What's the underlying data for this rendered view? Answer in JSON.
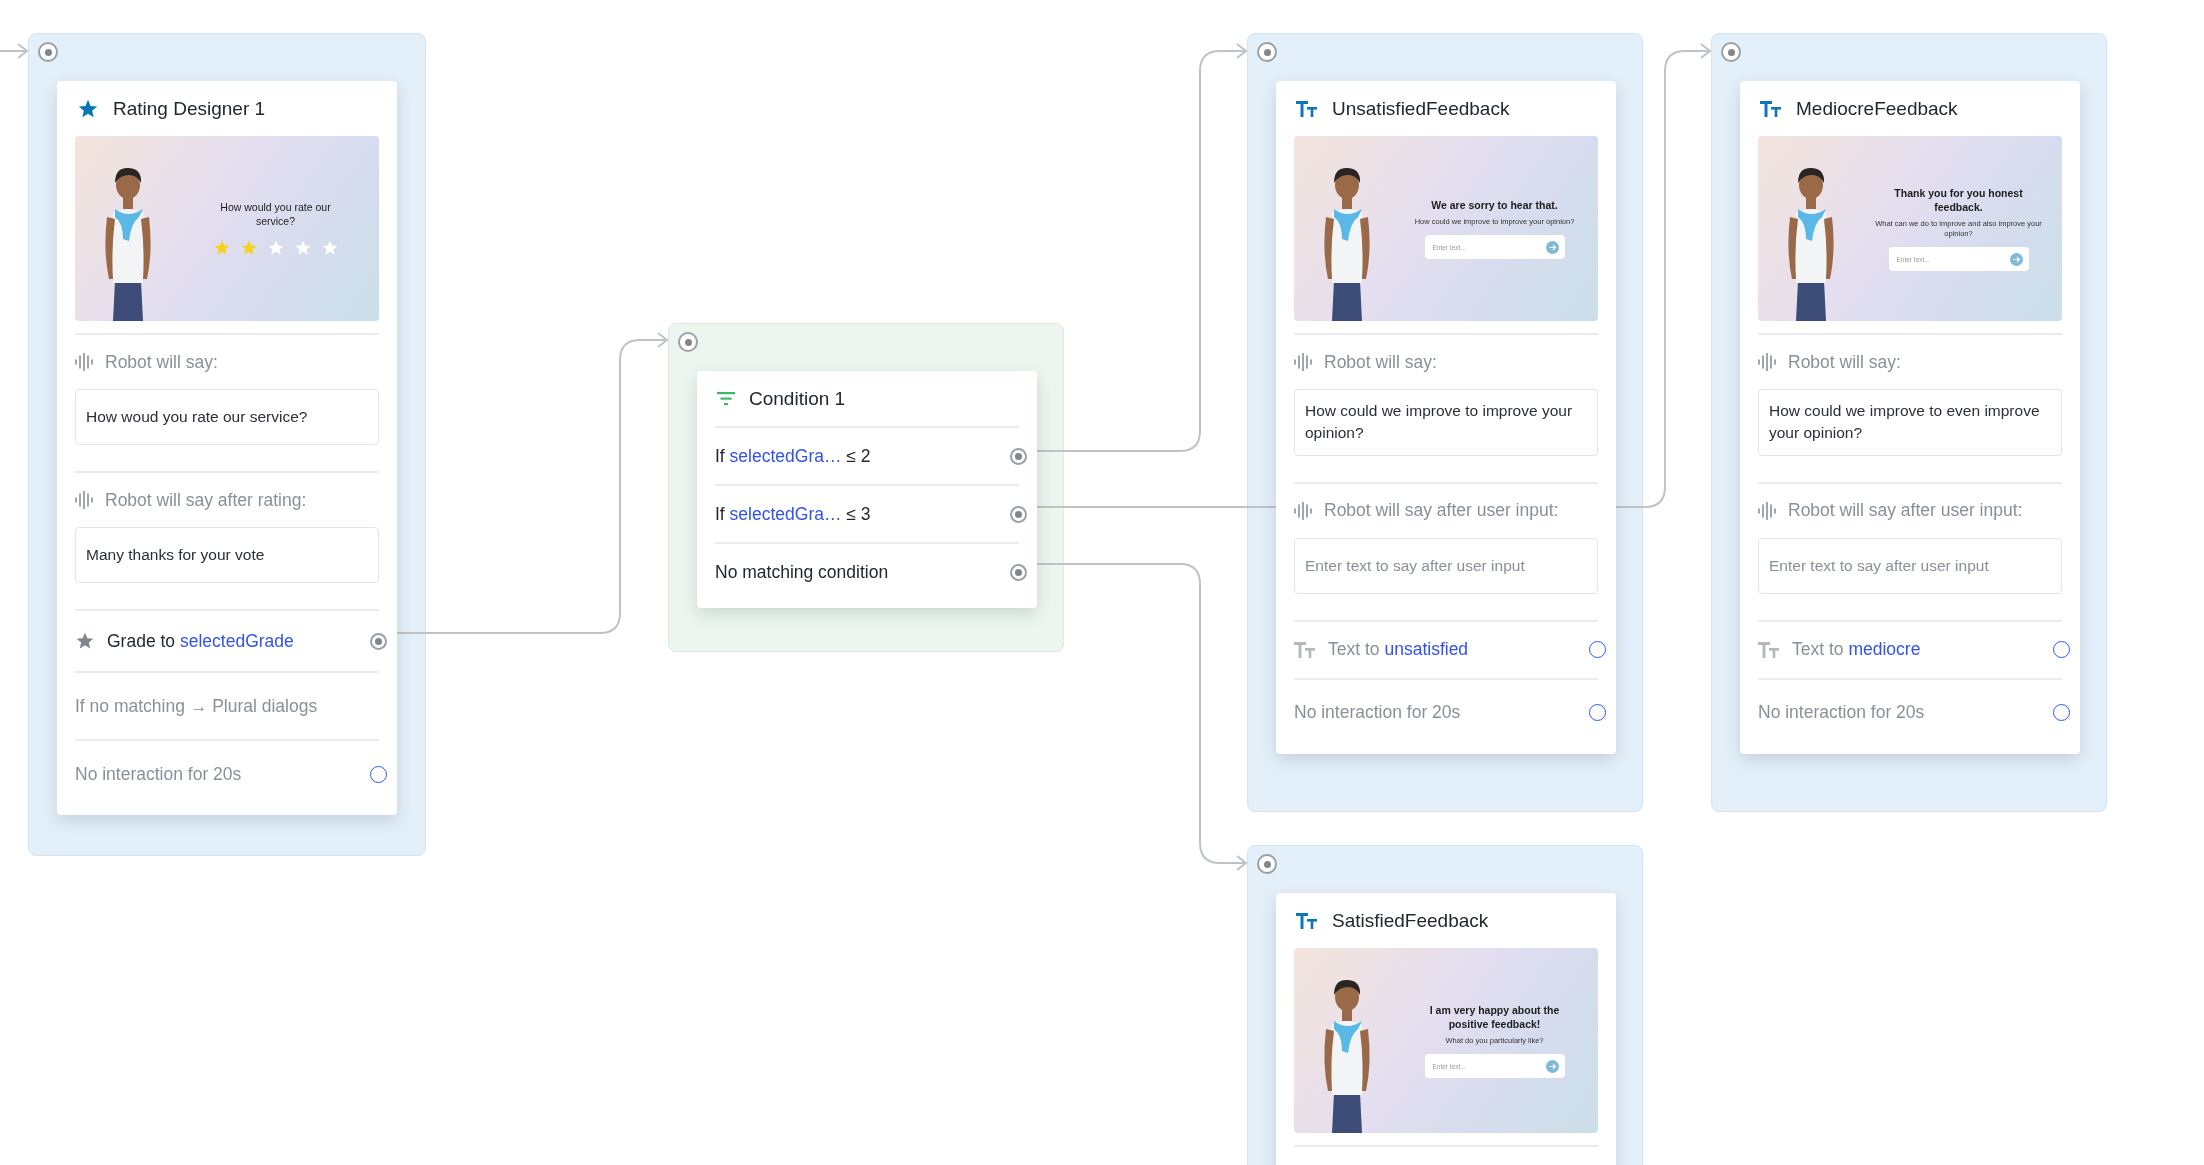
{
  "nodes": [
    {
      "kind": "rating",
      "title": "Rating Designer 1",
      "preview": {
        "kind": "rating",
        "heading": "How would you rate our service?",
        "stars": 2
      },
      "sections": [
        {
          "label": "Robot will say:",
          "value": "How woud you rate our service?"
        },
        {
          "label": "Robot will say after rating:",
          "value": "Many thanks for your vote"
        }
      ],
      "rows": [
        {
          "kind": "grade",
          "prefix": "Grade to",
          "variable": "selectedGrade",
          "connected": true
        },
        {
          "kind": "note",
          "text": "If no matching → Plural dialogs"
        },
        {
          "kind": "timeout",
          "text": "No interaction for 20s",
          "connected": false
        }
      ]
    },
    {
      "kind": "condition",
      "title": "Condition 1",
      "rows": [
        {
          "kind": "if",
          "prefix": "If",
          "variable": "selectedGra…",
          "operator": "≤ 2",
          "connected": true
        },
        {
          "kind": "if",
          "prefix": "If",
          "variable": "selectedGra…",
          "operator": "≤ 3",
          "connected": true
        },
        {
          "kind": "else",
          "text": "No matching condition",
          "connected": true
        }
      ]
    },
    {
      "kind": "input",
      "title": "UnsatisfiedFeedback",
      "preview": {
        "kind": "input",
        "heading": "We are sorry to hear that.",
        "subtext": "How could we improve to improve your opinion?",
        "placeholder": "Enter text..."
      },
      "sections": [
        {
          "label": "Robot will say:",
          "value": "How could we improve to improve your opinion?"
        },
        {
          "label": "Robot will say after user input:",
          "placeholder": "Enter text to say after user input"
        }
      ],
      "rows": [
        {
          "kind": "text",
          "prefix": "Text to",
          "variable": "unsatisfied",
          "connected": false
        },
        {
          "kind": "timeout",
          "text": "No interaction for 20s",
          "connected": false
        }
      ]
    },
    {
      "kind": "input",
      "title": "MediocreFeedback",
      "preview": {
        "kind": "input",
        "heading": "Thank you for you  honest feedback.",
        "subtext": "What can we do to improve and also improve your opinion?",
        "placeholder": "Enter text..."
      },
      "sections": [
        {
          "label": "Robot will say:",
          "value": "How could we improve to even improve your opinion?"
        },
        {
          "label": "Robot will say after user input:",
          "placeholder": "Enter text to say after user input"
        }
      ],
      "rows": [
        {
          "kind": "text",
          "prefix": "Text to",
          "variable": "mediocre",
          "connected": false
        },
        {
          "kind": "timeout",
          "text": "No interaction for 20s",
          "connected": false
        }
      ]
    },
    {
      "kind": "input",
      "title": "SatisfiedFeedback",
      "preview": {
        "kind": "input",
        "heading": "I am very happy about the positive feedback!",
        "subtext": "What do you particularly like?",
        "placeholder": "Enter text..."
      }
    }
  ]
}
